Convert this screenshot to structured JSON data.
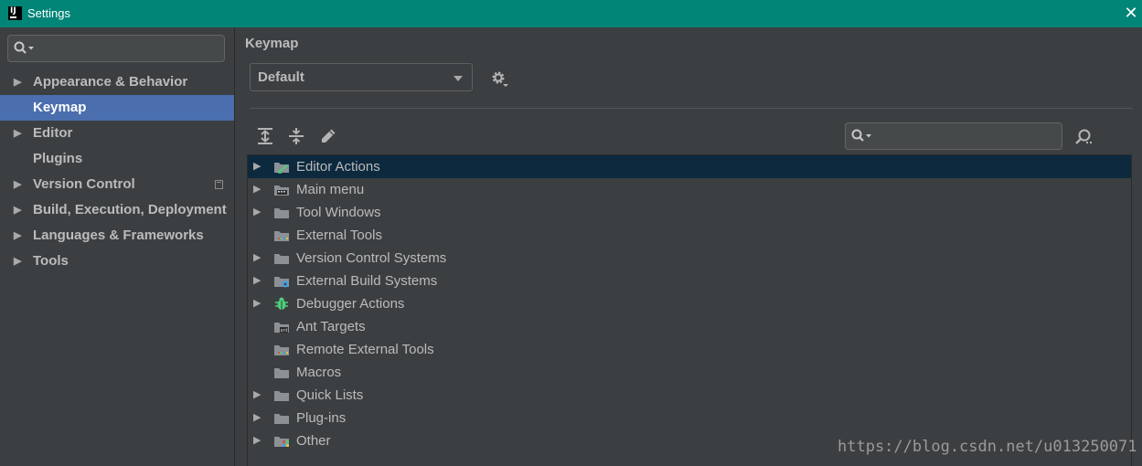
{
  "window": {
    "title": "Settings",
    "logo_text": "IJ"
  },
  "sidebar": {
    "search_placeholder": "",
    "items": [
      {
        "label": "Appearance & Behavior",
        "expandable": true,
        "selected": false
      },
      {
        "label": "Keymap",
        "expandable": false,
        "selected": true
      },
      {
        "label": "Editor",
        "expandable": true,
        "selected": false
      },
      {
        "label": "Plugins",
        "expandable": false,
        "selected": false
      },
      {
        "label": "Version Control",
        "expandable": true,
        "selected": false,
        "badge_icon": "copy-icon"
      },
      {
        "label": "Build, Execution, Deployment",
        "expandable": true,
        "selected": false
      },
      {
        "label": "Languages & Frameworks",
        "expandable": true,
        "selected": false
      },
      {
        "label": "Tools",
        "expandable": true,
        "selected": false
      }
    ]
  },
  "main": {
    "title": "Keymap",
    "keymap_select": {
      "value": "Default"
    },
    "toolbar": [
      "expand-all-icon",
      "collapse-all-icon",
      "edit-pencil-icon"
    ],
    "search_placeholder": "",
    "tree": [
      {
        "label": "Editor Actions",
        "expandable": true,
        "selected": true,
        "icon": "editor-actions-icon"
      },
      {
        "label": "Main menu",
        "expandable": true,
        "selected": false,
        "icon": "main-menu-icon"
      },
      {
        "label": "Tool Windows",
        "expandable": true,
        "selected": false,
        "icon": "folder-icon"
      },
      {
        "label": "External Tools",
        "expandable": false,
        "selected": false,
        "icon": "external-tools-icon"
      },
      {
        "label": "Version Control Systems",
        "expandable": true,
        "selected": false,
        "icon": "folder-icon"
      },
      {
        "label": "External Build Systems",
        "expandable": true,
        "selected": false,
        "icon": "external-build-icon"
      },
      {
        "label": "Debugger Actions",
        "expandable": true,
        "selected": false,
        "icon": "debugger-bug-icon"
      },
      {
        "label": "Ant Targets",
        "expandable": false,
        "selected": false,
        "icon": "ant-targets-icon"
      },
      {
        "label": "Remote External Tools",
        "expandable": false,
        "selected": false,
        "icon": "external-tools-icon"
      },
      {
        "label": "Macros",
        "expandable": false,
        "selected": false,
        "icon": "folder-icon"
      },
      {
        "label": "Quick Lists",
        "expandable": true,
        "selected": false,
        "icon": "folder-icon"
      },
      {
        "label": "Plug-ins",
        "expandable": true,
        "selected": false,
        "icon": "folder-icon"
      },
      {
        "label": "Other",
        "expandable": true,
        "selected": false,
        "icon": "other-icon"
      }
    ]
  },
  "watermark": "https://blog.csdn.net/u013250071",
  "colors": {
    "titlebar": "#008577",
    "selection": "#4b6eaf",
    "tree_selection": "#0d293e",
    "background": "#3c3f41"
  }
}
